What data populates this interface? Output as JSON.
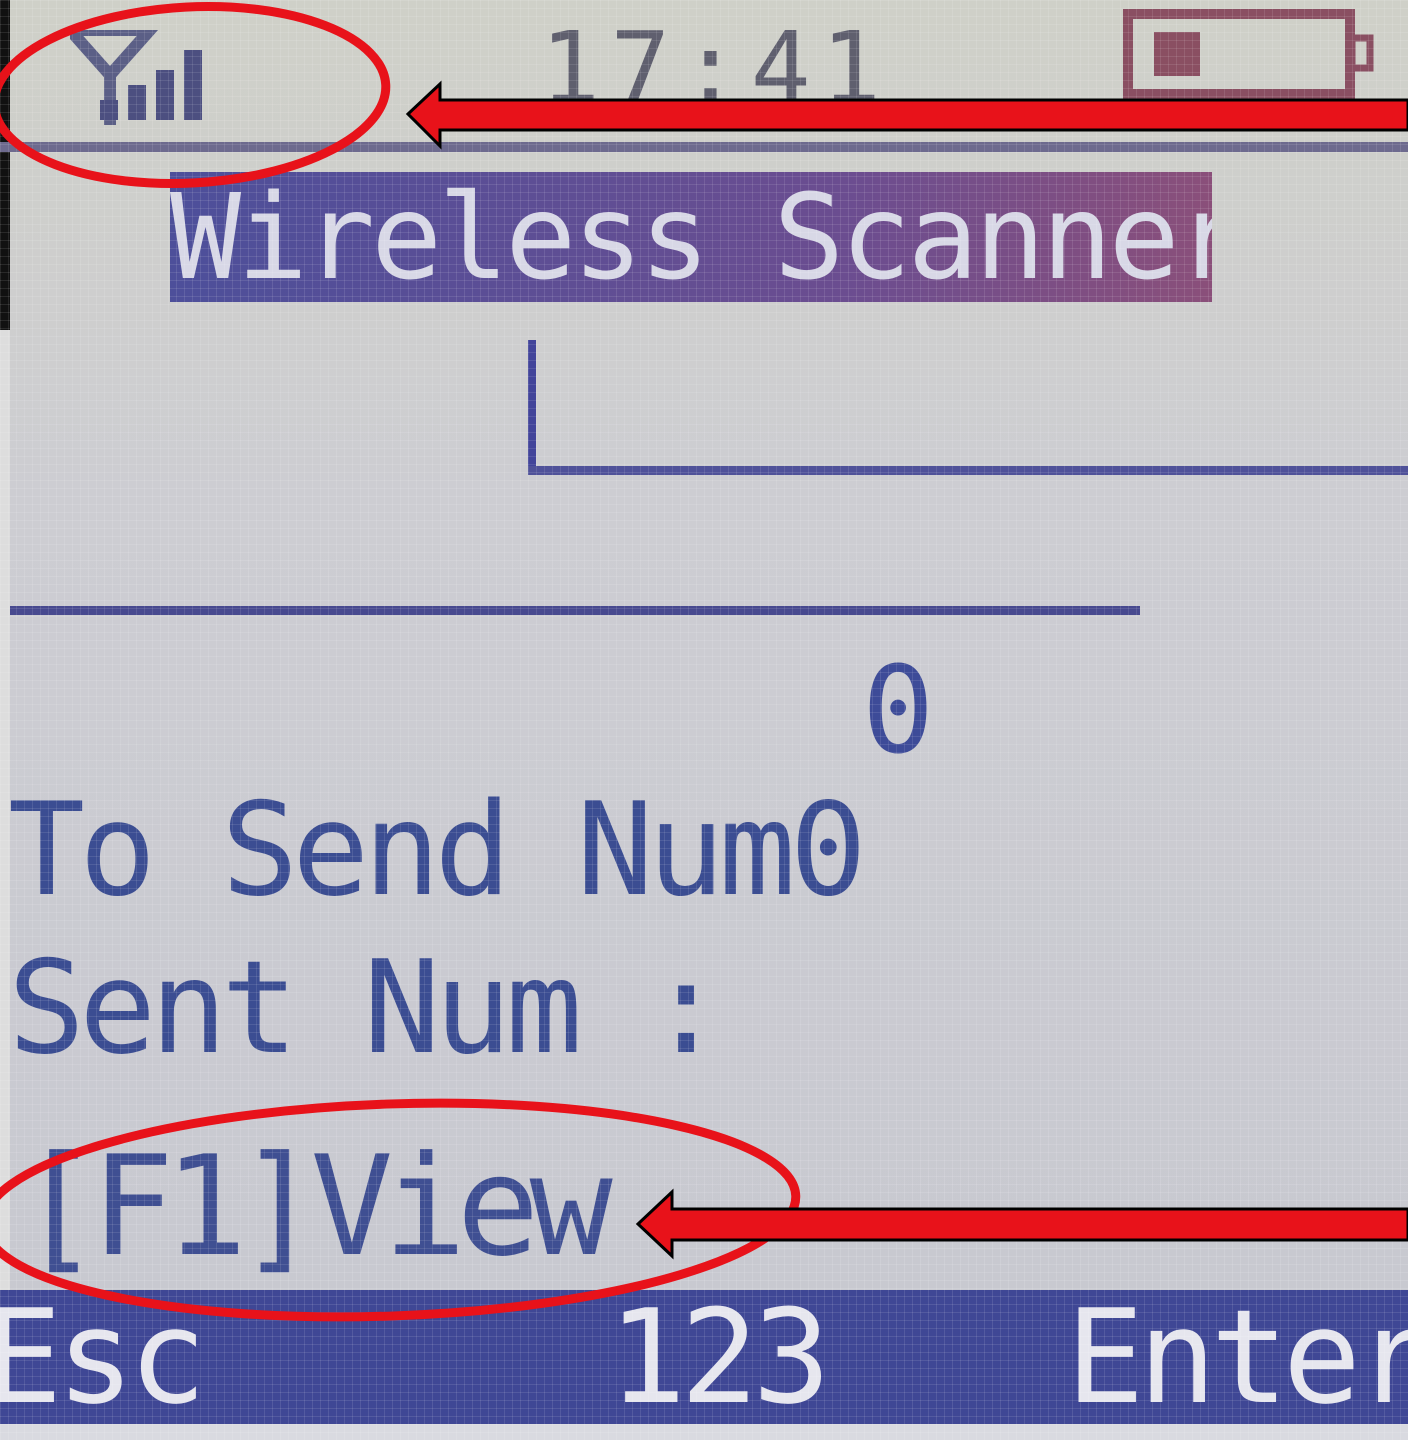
{
  "status": {
    "time": "17:41",
    "signal_icon": "signal-strength-icon",
    "battery_icon": "battery-icon"
  },
  "screen": {
    "title": "Wireless Scanner",
    "count": "0",
    "to_send_label": "To Send Num0",
    "sent_label": "Sent Num :",
    "f1_hint": "[F1]View"
  },
  "softkeys": {
    "left": "Esc",
    "center": "123",
    "right": "Enter"
  },
  "colors": {
    "lcd_text": "#3b4d92",
    "highlight_bar": "#4d4f9a",
    "annotation_red": "#e8121a"
  }
}
